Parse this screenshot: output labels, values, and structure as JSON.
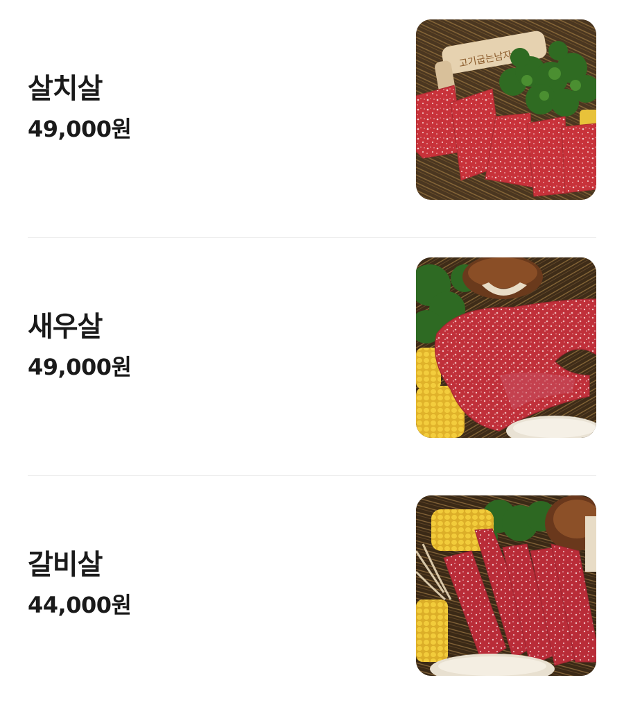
{
  "menu": {
    "items": [
      {
        "name": "살치살",
        "price": "49,000원",
        "image": "beef-chuck-flap-photo"
      },
      {
        "name": "새우살",
        "price": "49,000원",
        "image": "beef-rib-cap-photo"
      },
      {
        "name": "갈비살",
        "price": "44,000원",
        "image": "beef-rib-finger-photo"
      }
    ],
    "image_1_sign_text": "고기굽는남자"
  },
  "colors": {
    "text": "#1a1a1a",
    "divider": "#ececec",
    "background": "#ffffff"
  }
}
